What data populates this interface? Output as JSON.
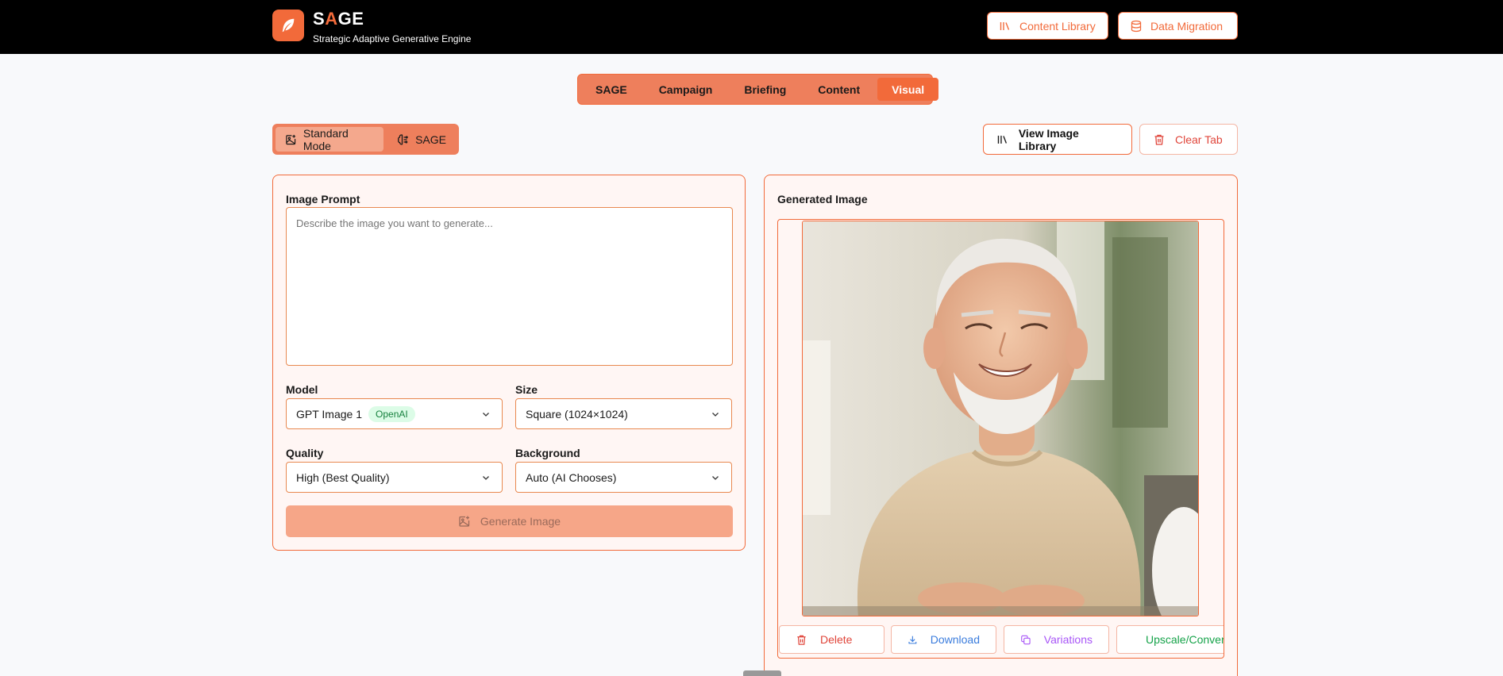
{
  "header": {
    "brand_first": "S",
    "brand_accent": "A",
    "brand_rest": "GE",
    "subtitle": "Strategic Adaptive Generative Engine",
    "content_library_label": "Content Library",
    "data_migration_label": "Data Migration",
    "accent_color": "#f26a3a"
  },
  "tabs": [
    {
      "label": "SAGE",
      "active": false
    },
    {
      "label": "Campaign",
      "active": false
    },
    {
      "label": "Briefing",
      "active": false
    },
    {
      "label": "Content",
      "active": false
    },
    {
      "label": "Visual",
      "active": true
    }
  ],
  "mode": {
    "standard_label": "Standard Mode",
    "sage_label": "SAGE",
    "active": "standard"
  },
  "actions": {
    "view_library_label": "View Image Library",
    "clear_tab_label": "Clear Tab"
  },
  "form": {
    "prompt_label": "Image Prompt",
    "prompt_placeholder": "Describe the image you want to generate...",
    "model_label": "Model",
    "model_value": "GPT Image 1",
    "model_badge": "OpenAI",
    "size_label": "Size",
    "size_value": "Square (1024×1024)",
    "quality_label": "Quality",
    "quality_value": "High (Best Quality)",
    "background_label": "Background",
    "background_value": "Auto (AI Chooses)",
    "generate_label": "Generate Image"
  },
  "output": {
    "title": "Generated Image",
    "delete_label": "Delete",
    "download_label": "Download",
    "variations_label": "Variations",
    "upscale_label": "Upscale/Convert"
  }
}
